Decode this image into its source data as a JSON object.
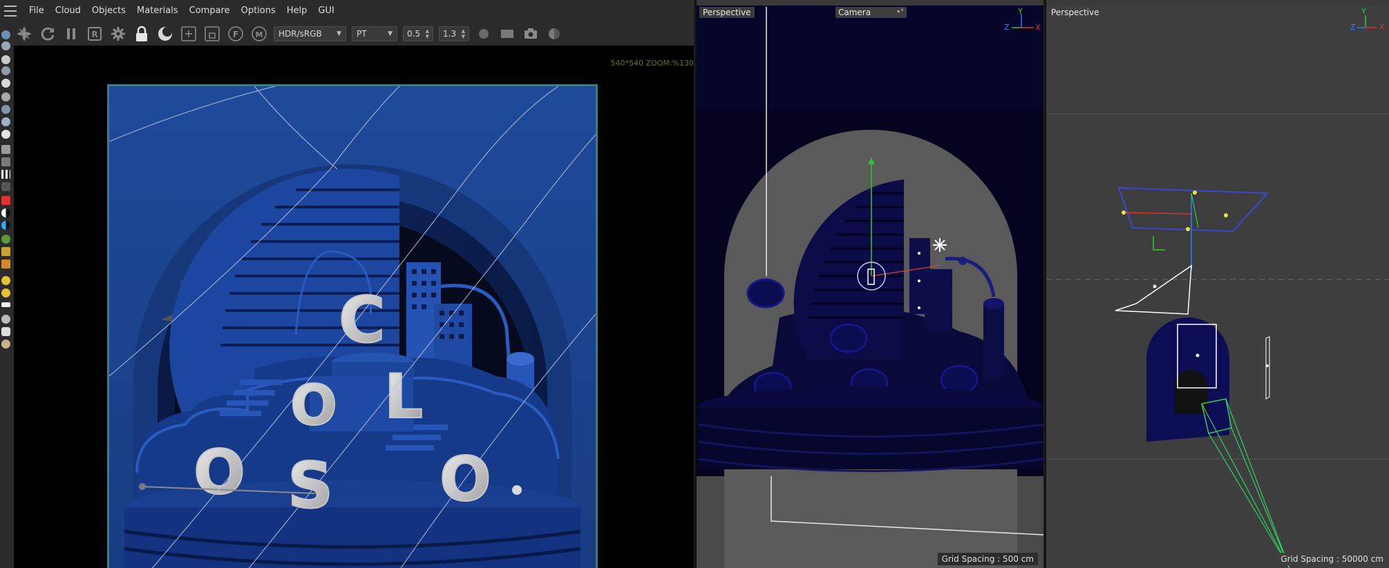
{
  "menu": [
    "File",
    "Cloud",
    "Objects",
    "Materials",
    "Compare",
    "Options",
    "Help",
    "GUI"
  ],
  "toolbar": {
    "icons": [
      "octane-logo-icon",
      "refresh-icon",
      "pause-icon",
      "render-region-icon",
      "settings-gear-icon",
      "lock-icon",
      "sphere-icon",
      "add-region-icon",
      "clay-icon",
      "focus-icon",
      "pick-icon"
    ],
    "color_space": "HDR/sRGB",
    "kernel": "PT",
    "value_a": "0.5",
    "value_b": "1.3",
    "trailing_icons": [
      "material-ball-icon",
      "film-icon",
      "camera-snapshot-icon",
      "octane-sphere-icon"
    ]
  },
  "render": {
    "zoom_readout": "540*540 ZOOM:%130"
  },
  "viewport_camera": {
    "label": "Perspective",
    "camera_select": "Camera",
    "camera_select_extra": "•°",
    "grid_spacing": "Grid Spacing : 500 cm",
    "axes": {
      "x": "X",
      "y": "Y",
      "z": "Z"
    }
  },
  "viewport_perspective": {
    "label": "Perspective",
    "grid_spacing": "Grid Spacing : 50000 cm",
    "axes": {
      "x": "X",
      "y": "Y",
      "z": "Z"
    }
  },
  "colors": {
    "accent_blue": "#1f4fa8",
    "axis_x": "#e03030",
    "axis_y": "#30d030",
    "axis_z": "#3080ff"
  }
}
